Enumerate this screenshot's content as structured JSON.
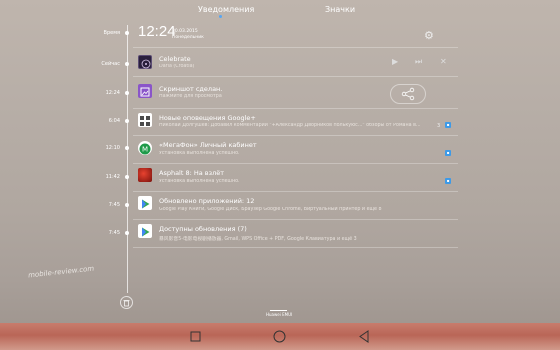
{
  "tabs": [
    {
      "label": "Уведомления",
      "active": true
    },
    {
      "label": "Значки",
      "active": false
    }
  ],
  "header": {
    "time": "12:24",
    "date": "30.03.2015",
    "weekday": "Понедельник",
    "time_label": "Время"
  },
  "timeline_labels": [
    "Время",
    "Сейчас",
    "12:24",
    "6:04",
    "12:10",
    "11:42",
    "7:45",
    "7:45"
  ],
  "notifications": [
    {
      "title": "Celebrate",
      "text": "Darla (Croatia)",
      "icon": "music-album-icon",
      "icon_color": "#2a1f3d"
    },
    {
      "title": "Скриншот сделан.",
      "text": "Нажмите для просмотра",
      "icon": "screenshot-icon",
      "icon_color": "#8a55c9"
    },
    {
      "title": "Новые оповещения Google+",
      "text": "Николай Долгушев: Добавил комментарий \"+Александр Дворников полькуюс...\" обзоры от Романа в...",
      "icon": "google-plus-icon",
      "icon_color": "#ffffff",
      "count": "3"
    },
    {
      "title": "«МегаФон» Личный кабинет",
      "text": "Установка выполнена успешно.",
      "icon": "megafon-icon",
      "icon_color": "#ffffff"
    },
    {
      "title": "Asphalt 8: На взлёт",
      "text": "Установка выполнена успешно.",
      "icon": "asphalt-game-icon",
      "icon_color": "#b0261f"
    },
    {
      "title": "Обновлено приложений: 12",
      "text": "Google Play Книги, Google Диск, Браузер Google Chrome, Виртуальный принтер и ещё 8",
      "icon": "play-store-icon",
      "icon_color": "#ffffff"
    },
    {
      "title": "Доступны обновления (7)",
      "text": "暴风影音5-电影电视剧播放器, Gmail, WPS Office + PDF, Google Клавиатура и ещё 3",
      "icon": "play-store-icon",
      "icon_color": "#ffffff",
      "count": "3"
    }
  ],
  "bottom": {
    "handle_label": "Huawei EMUI",
    "watermark": "mobile-review.com"
  },
  "colors": {
    "accent": "#58a6f3",
    "badge": "#3d9ae8",
    "navbar": "#b96657"
  }
}
